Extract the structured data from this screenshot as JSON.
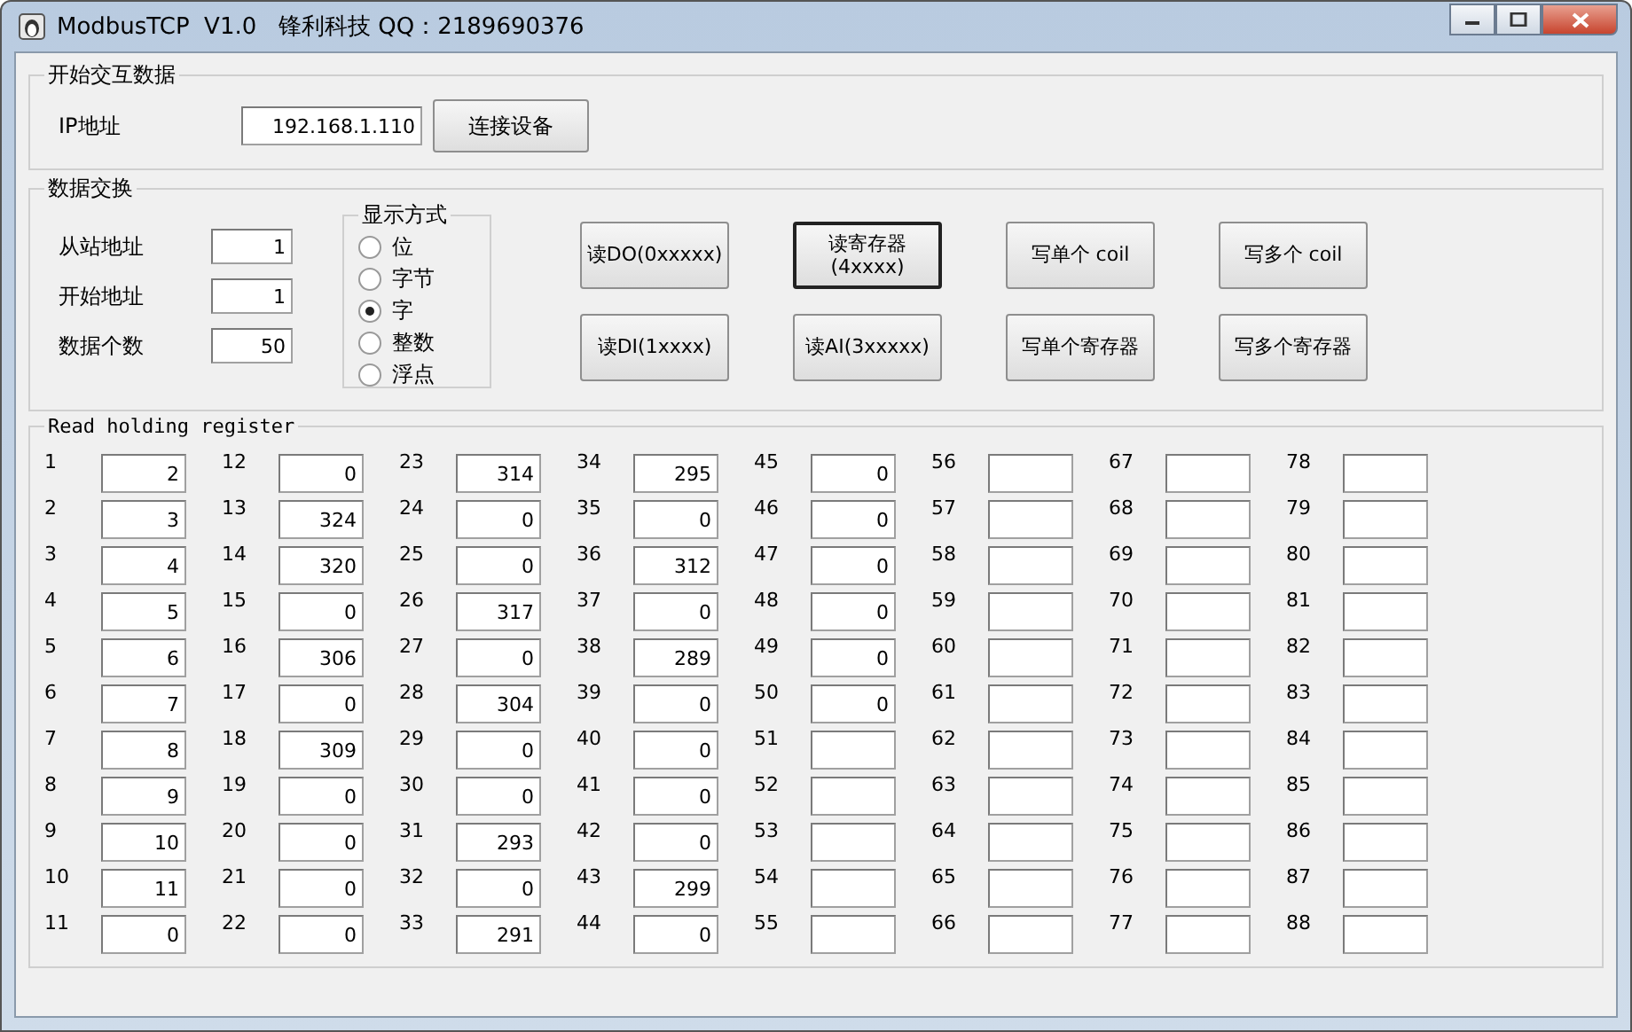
{
  "window": {
    "title": "ModbusTCP  V1.0   锋利科技 QQ：2189690376"
  },
  "connect_group": {
    "title": "开始交互数据",
    "ip_label": "IP地址",
    "ip_value": "192.168.1.110",
    "connect_button": "连接设备"
  },
  "exchange_group": {
    "title": "数据交换",
    "fields": [
      {
        "label": "从站地址",
        "value": "1"
      },
      {
        "label": "开始地址",
        "value": "1"
      },
      {
        "label": "数据个数",
        "value": "50"
      }
    ],
    "display_mode": {
      "title": "显示方式",
      "options": [
        {
          "label": "位",
          "selected": false
        },
        {
          "label": "字节",
          "selected": false
        },
        {
          "label": "字",
          "selected": true
        },
        {
          "label": "整数",
          "selected": false
        },
        {
          "label": "浮点",
          "selected": false
        }
      ]
    },
    "buttons": [
      {
        "label": "读DO(0xxxxx)",
        "focused": false
      },
      {
        "label": "读寄存器\n(4xxxx)",
        "focused": true
      },
      {
        "label": "写单个 coil",
        "focused": false
      },
      {
        "label": "写多个 coil",
        "focused": false
      },
      {
        "label": "读DI(1xxxx)",
        "focused": false
      },
      {
        "label": "读AI(3xxxxx)",
        "focused": false
      },
      {
        "label": "写单个寄存器",
        "focused": false
      },
      {
        "label": "写多个寄存器",
        "focused": false
      }
    ]
  },
  "registers_group": {
    "title": "Read holding register",
    "registers": [
      {
        "label": "1",
        "value": "2"
      },
      {
        "label": "2",
        "value": "3"
      },
      {
        "label": "3",
        "value": "4"
      },
      {
        "label": "4",
        "value": "5"
      },
      {
        "label": "5",
        "value": "6"
      },
      {
        "label": "6",
        "value": "7"
      },
      {
        "label": "7",
        "value": "8"
      },
      {
        "label": "8",
        "value": "9"
      },
      {
        "label": "9",
        "value": "10"
      },
      {
        "label": "10",
        "value": "11"
      },
      {
        "label": "11",
        "value": "0"
      },
      {
        "label": "12",
        "value": "0"
      },
      {
        "label": "13",
        "value": "324"
      },
      {
        "label": "14",
        "value": "320"
      },
      {
        "label": "15",
        "value": "0"
      },
      {
        "label": "16",
        "value": "306"
      },
      {
        "label": "17",
        "value": "0"
      },
      {
        "label": "18",
        "value": "309"
      },
      {
        "label": "19",
        "value": "0"
      },
      {
        "label": "20",
        "value": "0"
      },
      {
        "label": "21",
        "value": "0"
      },
      {
        "label": "22",
        "value": "0"
      },
      {
        "label": "23",
        "value": "314"
      },
      {
        "label": "24",
        "value": "0"
      },
      {
        "label": "25",
        "value": "0"
      },
      {
        "label": "26",
        "value": "317"
      },
      {
        "label": "27",
        "value": "0"
      },
      {
        "label": "28",
        "value": "304"
      },
      {
        "label": "29",
        "value": "0"
      },
      {
        "label": "30",
        "value": "0"
      },
      {
        "label": "31",
        "value": "293"
      },
      {
        "label": "32",
        "value": "0"
      },
      {
        "label": "33",
        "value": "291"
      },
      {
        "label": "34",
        "value": "295"
      },
      {
        "label": "35",
        "value": "0"
      },
      {
        "label": "36",
        "value": "312"
      },
      {
        "label": "37",
        "value": "0"
      },
      {
        "label": "38",
        "value": "289"
      },
      {
        "label": "39",
        "value": "0"
      },
      {
        "label": "40",
        "value": "0"
      },
      {
        "label": "41",
        "value": "0"
      },
      {
        "label": "42",
        "value": "0"
      },
      {
        "label": "43",
        "value": "299"
      },
      {
        "label": "44",
        "value": "0"
      },
      {
        "label": "45",
        "value": "0"
      },
      {
        "label": "46",
        "value": "0"
      },
      {
        "label": "47",
        "value": "0"
      },
      {
        "label": "48",
        "value": "0"
      },
      {
        "label": "49",
        "value": "0"
      },
      {
        "label": "50",
        "value": "0"
      },
      {
        "label": "51"
      },
      {
        "label": "52"
      },
      {
        "label": "53"
      },
      {
        "label": "54"
      },
      {
        "label": "55"
      },
      {
        "label": "56"
      },
      {
        "label": "57"
      },
      {
        "label": "58"
      },
      {
        "label": "59"
      },
      {
        "label": "60"
      },
      {
        "label": "61"
      },
      {
        "label": "62"
      },
      {
        "label": "63"
      },
      {
        "label": "64"
      },
      {
        "label": "65"
      },
      {
        "label": "66"
      },
      {
        "label": "67"
      },
      {
        "label": "68"
      },
      {
        "label": "69"
      },
      {
        "label": "70"
      },
      {
        "label": "71"
      },
      {
        "label": "72"
      },
      {
        "label": "73"
      },
      {
        "label": "74"
      },
      {
        "label": "75"
      },
      {
        "label": "76"
      },
      {
        "label": "77"
      },
      {
        "label": "78"
      },
      {
        "label": "79"
      },
      {
        "label": "80"
      },
      {
        "label": "81"
      },
      {
        "label": "82"
      },
      {
        "label": "83"
      },
      {
        "label": "84"
      },
      {
        "label": "85"
      },
      {
        "label": "86"
      },
      {
        "label": "87"
      },
      {
        "label": "88"
      }
    ]
  }
}
